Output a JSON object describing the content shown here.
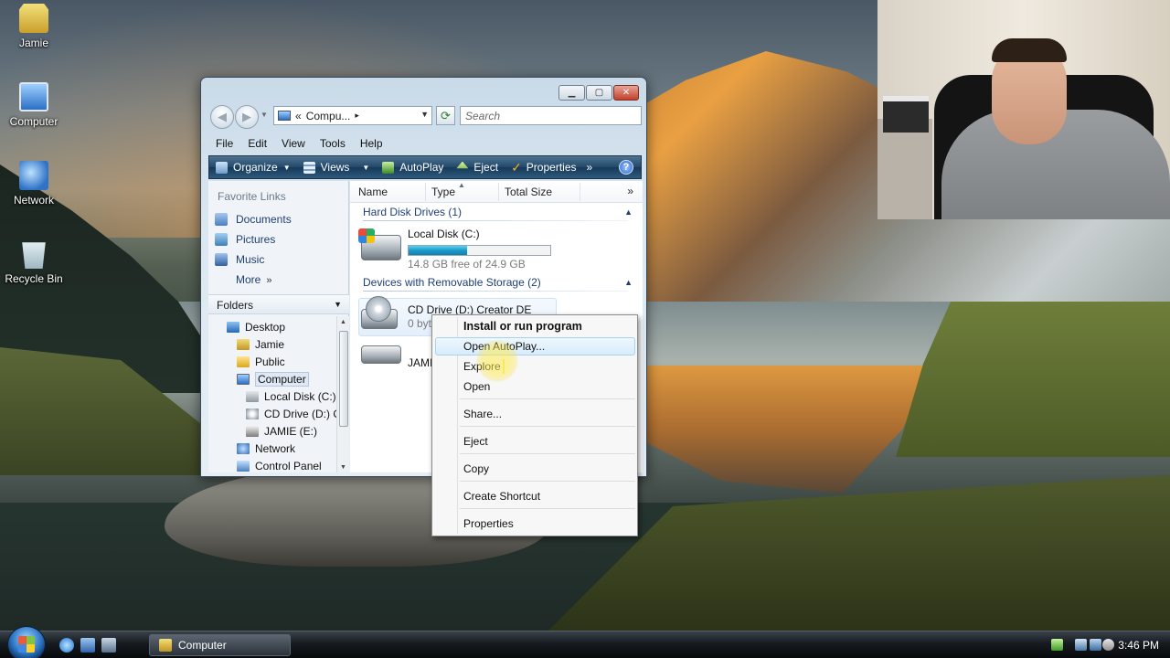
{
  "desktop": {
    "icons": [
      {
        "label": "Jamie",
        "icon": "user-folder-icon"
      },
      {
        "label": "Computer",
        "icon": "computer-icon"
      },
      {
        "label": "Network",
        "icon": "network-icon"
      },
      {
        "label": "Recycle Bin",
        "icon": "recycle-bin-icon"
      }
    ]
  },
  "window": {
    "address": {
      "prefix": "«",
      "crumb": "Compu...",
      "separator": "▸"
    },
    "search_placeholder": "Search",
    "menu": [
      "File",
      "Edit",
      "View",
      "Tools",
      "Help"
    ],
    "toolbar": {
      "organize": "Organize",
      "views": "Views",
      "autoplay": "AutoPlay",
      "eject": "Eject",
      "properties": "Properties",
      "more": "»",
      "help": "?"
    },
    "nav_pane": {
      "favorite_links_title": "Favorite Links",
      "favorites": [
        "Documents",
        "Pictures",
        "Music"
      ],
      "more": "More",
      "more_chevron": "»",
      "folders_title": "Folders",
      "tree": [
        {
          "label": "Desktop",
          "icon": "desktop-icon"
        },
        {
          "label": "Jamie",
          "icon": "user-folder-icon"
        },
        {
          "label": "Public",
          "icon": "folder-icon"
        },
        {
          "label": "Computer",
          "icon": "computer-icon",
          "selected": true
        },
        {
          "label": "Local Disk (C:)",
          "icon": "hard-disk-icon"
        },
        {
          "label": "CD Drive (D:) C",
          "icon": "cd-drive-icon"
        },
        {
          "label": "JAMIE (E:)",
          "icon": "usb-drive-icon"
        },
        {
          "label": "Network",
          "icon": "network-icon"
        },
        {
          "label": "Control Panel",
          "icon": "control-panel-icon"
        }
      ]
    },
    "content": {
      "columns": [
        "Name",
        "Type",
        "Total Size"
      ],
      "more_columns": "»",
      "groups": [
        {
          "title": "Hard Disk Drives (1)"
        },
        {
          "title": "Devices with Removable Storage (2)"
        }
      ],
      "local_disk": {
        "name": "Local Disk (C:)",
        "free_text": "14.8 GB free of 24.9 GB",
        "used_fraction": 0.41
      },
      "cd_drive": {
        "name": "CD Drive (D:) Creator DE",
        "sub": "0 byt"
      },
      "usb_drive": {
        "name": "JAMI"
      }
    }
  },
  "context_menu": {
    "items": [
      {
        "label": "Install or run program",
        "bold": true
      },
      {
        "label": "Open AutoPlay...",
        "hovered": true
      },
      {
        "label": "Explore"
      },
      {
        "label": "Open"
      },
      {
        "label": "Share..."
      },
      {
        "label": "Eject"
      },
      {
        "label": "Copy"
      },
      {
        "label": "Create Shortcut"
      },
      {
        "label": "Properties"
      }
    ]
  },
  "taskbar": {
    "task": "Computer",
    "clock": "3:46 PM"
  }
}
